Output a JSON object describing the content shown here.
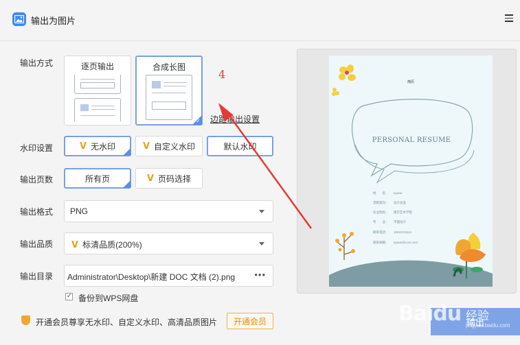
{
  "app": {
    "title": "输出为图片",
    "app_icon": "image-icon",
    "menu_icon": "hamburger-menu-icon"
  },
  "labels": {
    "output_mode": "输出方式",
    "watermark": "水印设置",
    "pages": "输出页数",
    "format": "输出格式",
    "quality": "输出品质",
    "directory": "输出目录"
  },
  "mode": {
    "per_page": "逐页输出",
    "long_image": "合成长图",
    "selected": "合成长图"
  },
  "margin_link": "边距输出设置",
  "annotation_number": "4",
  "watermark_options": {
    "none": "无水印",
    "custom": "自定义水印",
    "default": "默认水印",
    "selected": "无水印"
  },
  "page_options": {
    "all": "所有页",
    "select": "页码选择",
    "selected": "所有页"
  },
  "format": {
    "value": "PNG"
  },
  "quality": {
    "value": "标清品质(200%)"
  },
  "directory": {
    "value": "Administrator\\Desktop\\新建 DOC 文档 (2).png",
    "more": "•••"
  },
  "backup": {
    "label": "备份到WPS网盘",
    "checked": true
  },
  "promo": {
    "text": "开通会员尊享无水印、自定义水印、高清品质图片",
    "button": "开通会员",
    "icon": "vip-shield-icon"
  },
  "vip_mark": "V",
  "preview": {
    "header": "简历",
    "title": "PERSONAL RESUME",
    "rows": [
      {
        "k": "姓　　名：",
        "v": "ayuan"
      },
      {
        "k": "求职意向：",
        "v": "设计总监"
      },
      {
        "k": "毕业院校：",
        "v": "南京艺术学院"
      },
      {
        "k": "专　　业：",
        "v": "平面设计"
      },
      {
        "k": "联系电话：",
        "v": "15622211111"
      },
      {
        "k": "联系邮箱：",
        "v": "ayuan@com.com"
      }
    ]
  },
  "export_button": "输出",
  "watermark_overlay": {
    "brand": "Baidu",
    "cn": "经验",
    "url": "jingyan.baidu.com"
  },
  "colors": {
    "accent": "#5b8ee6",
    "selected_border": "#7aa0e0",
    "vip": "#e8a317",
    "arrow": "#e53935"
  }
}
